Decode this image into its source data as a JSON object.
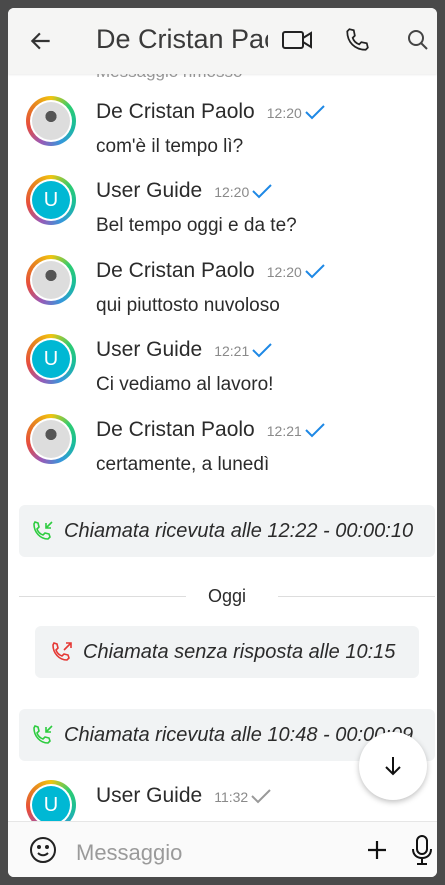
{
  "header": {
    "title": "De Cristan Paolo",
    "back_icon": "arrow-left-icon",
    "actions": [
      "video-call-icon",
      "phone-icon",
      "search-icon"
    ]
  },
  "removed_notice": "Messaggio rimosso",
  "messages": [
    {
      "sender": "De Cristan Paolo",
      "time": "12:20",
      "text": "com'è il tempo lì?",
      "avatar": "photo",
      "status": "sent"
    },
    {
      "sender": "User Guide",
      "time": "12:20",
      "text": "Bel tempo oggi e da te?",
      "avatar": "U",
      "status": "sent"
    },
    {
      "sender": "De Cristan Paolo",
      "time": "12:20",
      "text": "qui piuttosto nuvoloso",
      "avatar": "photo",
      "status": "sent"
    },
    {
      "sender": "User Guide",
      "time": "12:21",
      "text": "Ci vediamo al lavoro!",
      "avatar": "U",
      "status": "sent"
    },
    {
      "sender": "De Cristan Paolo",
      "time": "12:21",
      "text": "certamente, a lunedì",
      "avatar": "photo",
      "status": "sent"
    }
  ],
  "calls": [
    {
      "text": "Chiamata ricevuta alle 12:22 - 00:00:10",
      "type": "received",
      "color": "#2ecc40"
    },
    {
      "text": "Chiamata senza risposta alle 10:15",
      "type": "missed",
      "color": "#e53935"
    },
    {
      "text": "Chiamata ricevuta alle 10:48 - 00:00:09",
      "type": "received",
      "color": "#2ecc40"
    }
  ],
  "day_separator": "Oggi",
  "last_message": {
    "sender": "User Guide",
    "time": "11:32",
    "avatar": "U",
    "status": "pending"
  },
  "composer": {
    "placeholder": "Messaggio",
    "icons": [
      "emoji-icon",
      "plus-icon",
      "microphone-icon"
    ]
  },
  "colors": {
    "check": "#1e88e5",
    "avatar_bg": "#00b8d4"
  }
}
